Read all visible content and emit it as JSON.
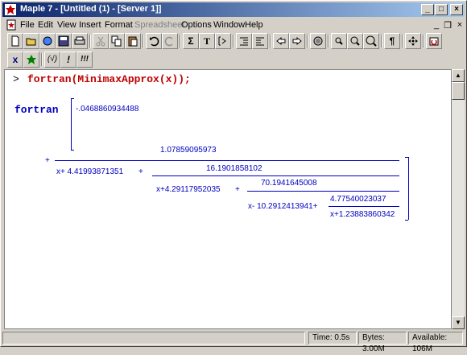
{
  "window": {
    "title": "Maple 7  - [Untitled (1) - [Server 1]]",
    "minimize_glyph": "_",
    "maximize_glyph": "□",
    "close_glyph": "×"
  },
  "menu": {
    "items": [
      "File",
      "Edit",
      "View",
      "Insert",
      "Format",
      "Spreadsheet",
      "Options",
      "Window",
      "Help"
    ],
    "disabled": "Spreadsheet",
    "mdi_minimize": "_",
    "mdi_restore": "❐",
    "mdi_close": "×"
  },
  "toolbar1": {
    "sum_label": "Σ",
    "text_label": "T",
    "pilcrow_label": "¶"
  },
  "toolbar2": {
    "x_label": "x",
    "paren_label": "(√)",
    "bang_label": "!",
    "bangs_label": "!!!"
  },
  "worksheet": {
    "prompt": ">",
    "command": "fortran(MinimaxApprox(x));",
    "output_name": "fortran",
    "first_term": "-.0468860934488",
    "plus": "+",
    "n1": "1.07859095973",
    "d1": "x+ 4.41993871351",
    "n2": "16.1901858102",
    "d2": "x+4.29117952035",
    "n3": "70.1941645008",
    "d3": "x- 10.2912413941+",
    "n4": "4.77540023037",
    "d4": "x+1.23883860342"
  },
  "status": {
    "time": "Time:  0.5s",
    "bytes": "Bytes: 3.00M",
    "available": "Available: 106M"
  },
  "colors": {
    "title_active": "#0a246a",
    "command": "#c00000",
    "output": "#0000c0"
  }
}
